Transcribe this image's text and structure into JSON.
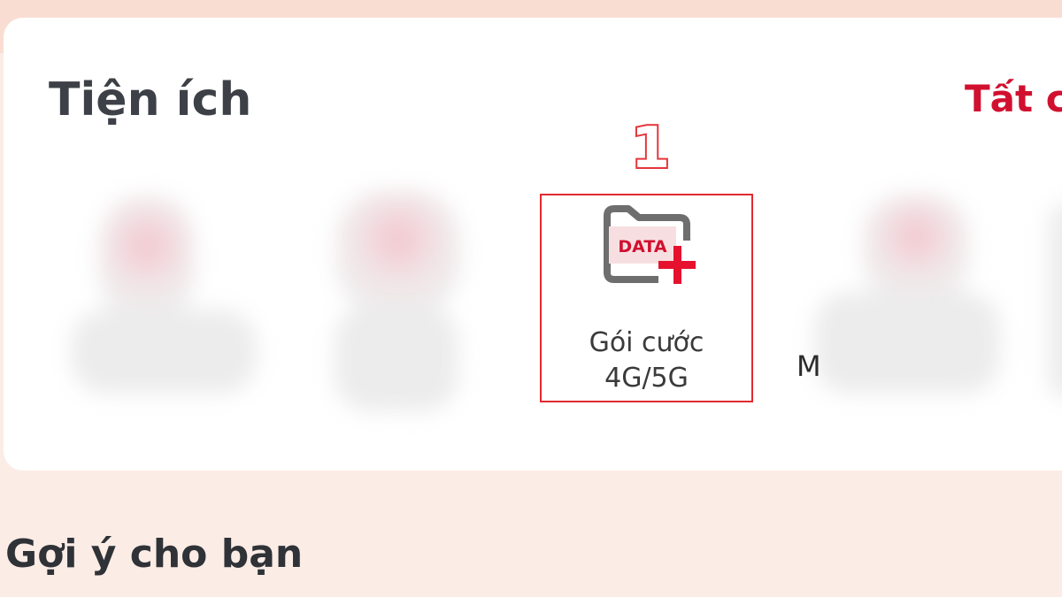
{
  "utilities": {
    "title": "Tiện ích",
    "see_all": "Tất c",
    "highlighted_item": {
      "icon_text": "DATA",
      "label_line1": "Gói cước",
      "label_line2": "4G/5G"
    },
    "annotation_number": "1",
    "partial_glyph": "M"
  },
  "suggestions": {
    "title": "Gợi ý cho bạn"
  },
  "colors": {
    "accent": "#d1102f",
    "highlight_border": "#e22a30",
    "page_background": "#fbece6",
    "card_background": "#ffffff"
  },
  "icons": {
    "highlighted_item_icon": "data-folder-plus-icon"
  }
}
